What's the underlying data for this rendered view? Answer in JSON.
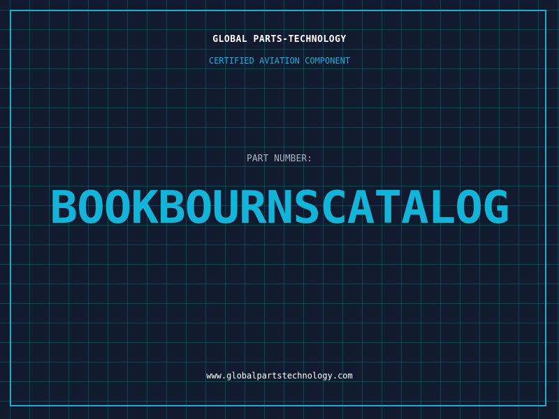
{
  "header": {
    "company": "GLOBAL PARTS-TECHNOLOGY",
    "subtitle": "CERTIFIED AVIATION COMPONENT"
  },
  "part": {
    "label": "PART NUMBER:",
    "number": "BOOKBOURNSCATALOG"
  },
  "footer": {
    "website": "www.globalpartstechnology.com"
  },
  "colors": {
    "background": "#111a2e",
    "grid": "#1e6e8c",
    "accent": "#14b4d8",
    "text": "#ffffff",
    "muted": "#a8b4c6"
  }
}
